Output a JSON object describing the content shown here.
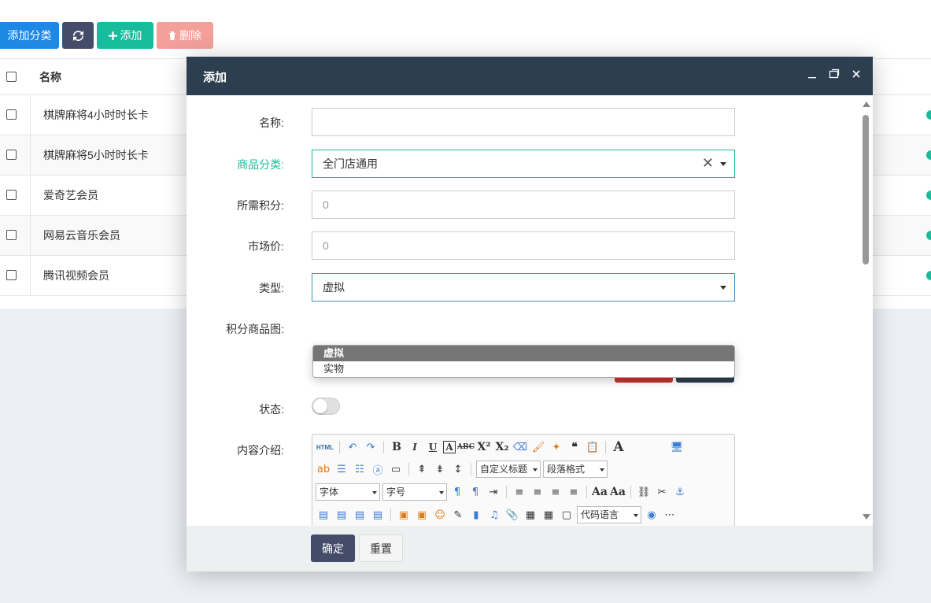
{
  "toolbar": {
    "add_category": "添加分类",
    "add": "添加",
    "delete": "删除"
  },
  "table": {
    "header_name": "名称",
    "rows": [
      {
        "name": "棋牌麻将4小时时长卡"
      },
      {
        "name": "棋牌麻将5小时时长卡"
      },
      {
        "name": "爱奇艺会员"
      },
      {
        "name": "网易云音乐会员"
      },
      {
        "name": "腾讯视频会员"
      }
    ]
  },
  "modal": {
    "title": "添加",
    "fields": {
      "name_label": "名称:",
      "name_value": "",
      "category_label": "商品分类:",
      "category_value": "全门店通用",
      "points_label": "所需积分:",
      "points_value": "0",
      "market_price_label": "市场价:",
      "market_price_value": "0",
      "type_label": "类型:",
      "type_value": "虚拟",
      "image_label": "积分商品图:",
      "status_label": "状态:",
      "content_label": "内容介绍:"
    },
    "type_options": [
      "虚拟",
      "实物"
    ],
    "editor": {
      "html_label": "HTML",
      "custom_title": "自定义标题",
      "paragraph_format": "段落格式",
      "font_family": "字体",
      "font_size": "字号",
      "code_language": "代码语言"
    },
    "footer": {
      "ok": "确定",
      "reset": "重置"
    }
  },
  "colors": {
    "header_bg": "#2c3e50",
    "accent_green": "#18bc9c",
    "primary_blue": "#1e88e5",
    "danger_light": "#f3a09a"
  }
}
